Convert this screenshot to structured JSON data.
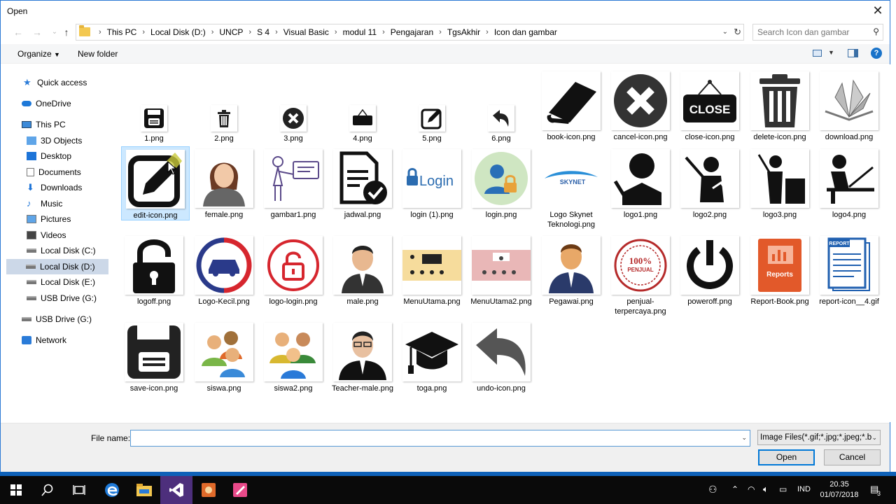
{
  "dialog": {
    "title": "Open",
    "breadcrumbs": [
      "This PC",
      "Local Disk (D:)",
      "UNCP",
      "S 4",
      "Visual Basic",
      "modul 11",
      "Pengajaran",
      "TgsAkhir",
      "Icon dan gambar"
    ],
    "search_placeholder": "Search Icon dan gambar",
    "organize_label": "Organize",
    "newfolder_label": "New folder"
  },
  "nav": {
    "items": [
      {
        "label": "Quick access",
        "icon": "star-icon"
      },
      {
        "label": "OneDrive",
        "icon": "cloud-icon"
      },
      {
        "label": "This PC",
        "icon": "pc-icon"
      },
      {
        "label": "3D Objects",
        "icon": "cube-icon"
      },
      {
        "label": "Desktop",
        "icon": "desktop-icon"
      },
      {
        "label": "Documents",
        "icon": "document-icon"
      },
      {
        "label": "Downloads",
        "icon": "download-icon"
      },
      {
        "label": "Music",
        "icon": "music-icon"
      },
      {
        "label": "Pictures",
        "icon": "pictures-icon"
      },
      {
        "label": "Videos",
        "icon": "video-icon"
      },
      {
        "label": "Local Disk (C:)",
        "icon": "drive-icon"
      },
      {
        "label": "Local Disk (D:)",
        "icon": "drive-icon"
      },
      {
        "label": "Local Disk (E:)",
        "icon": "drive-icon"
      },
      {
        "label": "USB Drive (G:)",
        "icon": "drive-icon"
      },
      {
        "label": "USB Drive (G:)",
        "icon": "usb-drive-icon"
      },
      {
        "label": "Network",
        "icon": "network-icon"
      }
    ]
  },
  "files": [
    "1.png",
    "2.png",
    "3.png",
    "4.png",
    "5.png",
    "6.png",
    "book-icon.png",
    "cancel-icon.png",
    "close-icon.png",
    "delete-icon.png",
    "download.png",
    "edit-icon.png",
    "female.png",
    "gambar1.png",
    "jadwal.png",
    "login (1).png",
    "login.png",
    "Logo Skynet Teknologi.png",
    "logo1.png",
    "logo2.png",
    "logo3.png",
    "logo4.png",
    "logoff.png",
    "Logo-Kecil.png",
    "logo-login.png",
    "male.png",
    "MenuUtama.png",
    "MenuUtama2.png",
    "Pegawai.png",
    "penjual-terpercaya.png",
    "poweroff.png",
    "Report-Book.png",
    "report-icon__4.gif",
    "save-icon.png",
    "siswa.png",
    "siswa2.png",
    "Teacher-male.png",
    "toga.png",
    "undo-icon.png"
  ],
  "thumb_text": {
    "close": "CLOSE",
    "login": "Login",
    "skynet": "SKYNET",
    "stamp": "100%",
    "stamp2": "PENJUAL",
    "reports": "Reports",
    "report": "REPORT"
  },
  "bottom": {
    "filename_label": "File name:",
    "filename_value": "",
    "filetype": "Image Files(*.gif;*.jpg;*.jpeg;*.b",
    "open_label": "Open",
    "cancel_label": "Cancel"
  },
  "taskbar": {
    "lang": "IND",
    "time": "20.35",
    "date": "01/07/2018",
    "notif_count": "3"
  }
}
